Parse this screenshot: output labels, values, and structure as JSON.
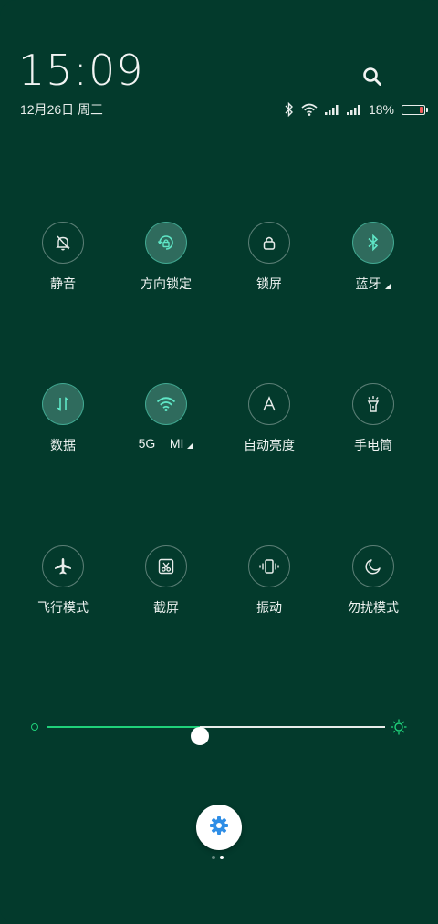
{
  "header": {
    "time": "15:09",
    "date": "12月26日 周三",
    "battery_percent_text": "18%",
    "battery_level": 0.18
  },
  "tiles": [
    {
      "label": "静音",
      "icon": "bell-off-icon",
      "on": false,
      "arrow": false
    },
    {
      "label": "方向锁定",
      "icon": "rotation-lock-icon",
      "on": true,
      "arrow": false
    },
    {
      "label": "锁屏",
      "icon": "lock-icon",
      "on": false,
      "arrow": false
    },
    {
      "label": "蓝牙",
      "icon": "bluetooth-icon",
      "on": true,
      "arrow": true
    },
    {
      "label": "数据",
      "icon": "mobile-data-icon",
      "on": true,
      "arrow": false
    },
    {
      "label": "5G    MI",
      "icon": "wifi-icon",
      "on": true,
      "arrow": true
    },
    {
      "label": "自动亮度",
      "icon": "auto-brightness-icon",
      "on": false,
      "arrow": false
    },
    {
      "label": "手电筒",
      "icon": "flashlight-icon",
      "on": false,
      "arrow": false
    },
    {
      "label": "飞行模式",
      "icon": "airplane-icon",
      "on": false,
      "arrow": false
    },
    {
      "label": "截屏",
      "icon": "screenshot-icon",
      "on": false,
      "arrow": false
    },
    {
      "label": "振动",
      "icon": "vibrate-icon",
      "on": false,
      "arrow": false
    },
    {
      "label": "勿扰模式",
      "icon": "moon-icon",
      "on": false,
      "arrow": false
    }
  ],
  "brightness": {
    "level": 0.45
  },
  "pager": {
    "pages": 2,
    "current": 2
  },
  "colors": {
    "background": "#033a2c",
    "accent": "#1fd17a",
    "active_icon": "#5fe6c6",
    "settings_icon": "#2f8ee6"
  }
}
